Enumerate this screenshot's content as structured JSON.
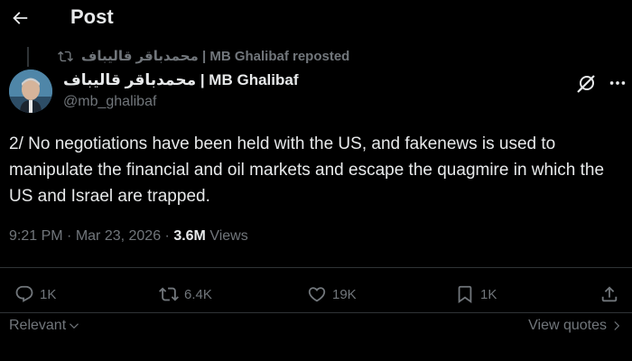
{
  "header": {
    "title": "Post",
    "back_icon": "arrow-left-icon"
  },
  "repost": {
    "text": "محمدباقر قالیباف | MB Ghalibaf reposted",
    "icon": "repost-icon"
  },
  "author": {
    "name": "محمدباقر قالیباف | MB Ghalibaf",
    "handle": "@mb_ghalibaf"
  },
  "tweet": {
    "text": "2/ No negotiations have been held with the US, and fakenews is used to manipulate the financial and oil markets and escape the quagmire in which the US and Israel are trapped."
  },
  "meta": {
    "time": "9:21 PM",
    "separator1": " · ",
    "date": "Mar 23, 2026",
    "separator2": " · ",
    "views_count": "3.6M",
    "views_label": " Views"
  },
  "actions": {
    "replies": "1K",
    "reposts": "6.4K",
    "likes": "19K",
    "bookmarks": "1K"
  },
  "footer": {
    "sort_label": "Relevant",
    "view_quotes": "View quotes"
  },
  "colors": {
    "background": "#000000",
    "text": "#e7e9ea",
    "secondary": "#71767b",
    "divider": "#2f3336"
  }
}
